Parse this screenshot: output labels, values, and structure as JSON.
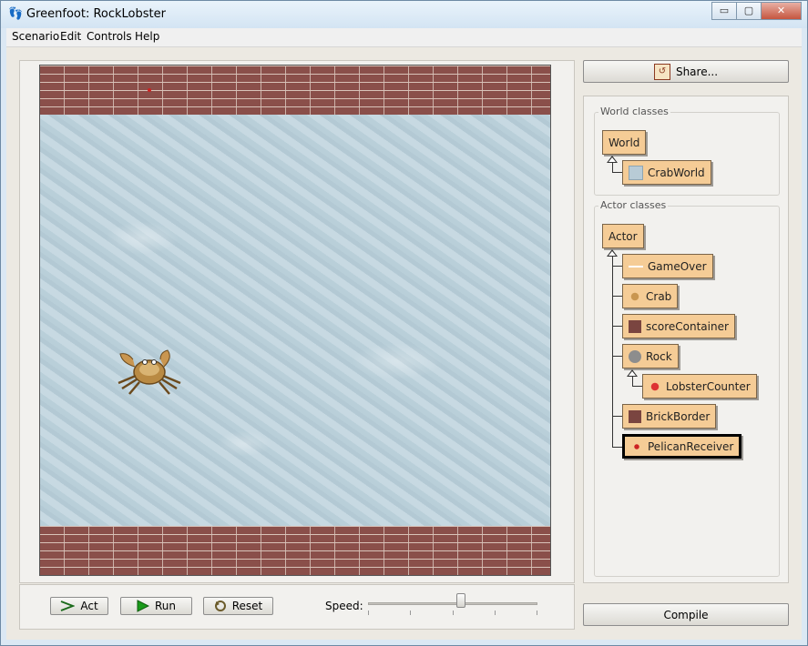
{
  "window": {
    "title": "Greenfoot: RockLobster"
  },
  "titlebar_buttons": {
    "minimize": "▭",
    "maximize": "▢",
    "close": "✕"
  },
  "menu": [
    "Scenario",
    "Edit",
    "Controls",
    "Help"
  ],
  "share": {
    "label": "Share..."
  },
  "world_classes": {
    "label": "World classes",
    "items": [
      "World",
      "CrabWorld"
    ]
  },
  "actor_classes": {
    "label": "Actor classes",
    "root": "Actor",
    "items": [
      "GameOver",
      "Crab",
      "scoreContainer",
      "Rock",
      "LobsterCounter",
      "BrickBorder",
      "PelicanReceiver"
    ],
    "selected": "PelicanReceiver"
  },
  "controls": {
    "act": "Act",
    "run": "Run",
    "reset": "Reset",
    "speed_label": "Speed:",
    "speed_level": 0.55
  },
  "compile": {
    "label": "Compile"
  },
  "colors": {
    "class_fill": "#f5cc96",
    "brick": "#8a4f4a",
    "water": "#c0d4de",
    "run_green": "#1a9a1a"
  },
  "icons": {
    "act": "arrow-right-icon",
    "run": "play-icon",
    "reset": "reset-icon",
    "share": "share-icon"
  }
}
